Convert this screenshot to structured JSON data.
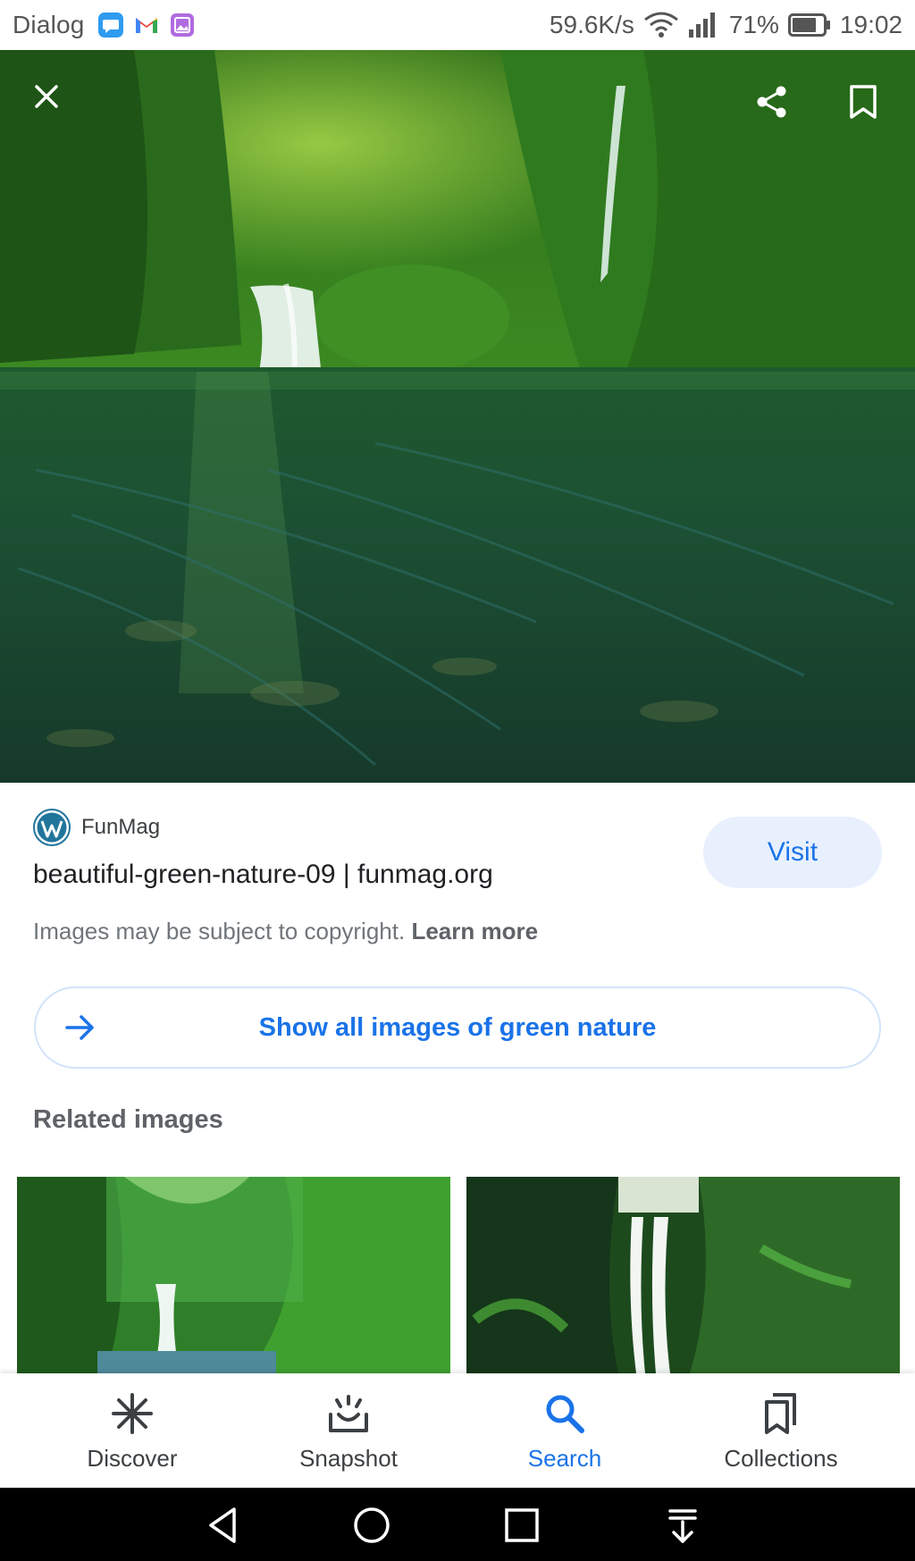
{
  "status_bar": {
    "app_name": "Dialog",
    "network_speed": "59.6K/s",
    "battery_percent": "71%",
    "time": "19:02",
    "notification_icons": [
      "messages-icon",
      "gmail-icon",
      "gallery-icon"
    ]
  },
  "hero": {
    "alt_icon_close": "close-icon",
    "alt_icon_share": "share-icon",
    "alt_icon_bookmark": "bookmark-icon"
  },
  "result": {
    "source_name": "FunMag",
    "title": "beautiful-green-nature-09 | funmag.org",
    "copyright_text": "Images may be subject to copyright.",
    "learn_more": "Learn more",
    "visit_label": "Visit"
  },
  "show_all": {
    "label": "Show all images of green nature"
  },
  "related": {
    "heading": "Related images"
  },
  "bottom_nav": {
    "items": [
      {
        "label": "Discover",
        "icon": "asterisk-icon"
      },
      {
        "label": "Snapshot",
        "icon": "snapshot-icon"
      },
      {
        "label": "Search",
        "icon": "search-icon",
        "active": true
      },
      {
        "label": "Collections",
        "icon": "collections-icon"
      }
    ]
  },
  "colors": {
    "accent": "#1a73e8",
    "visit_bg": "#e8f0fe",
    "text_primary": "#202124",
    "text_secondary": "#70757a"
  }
}
